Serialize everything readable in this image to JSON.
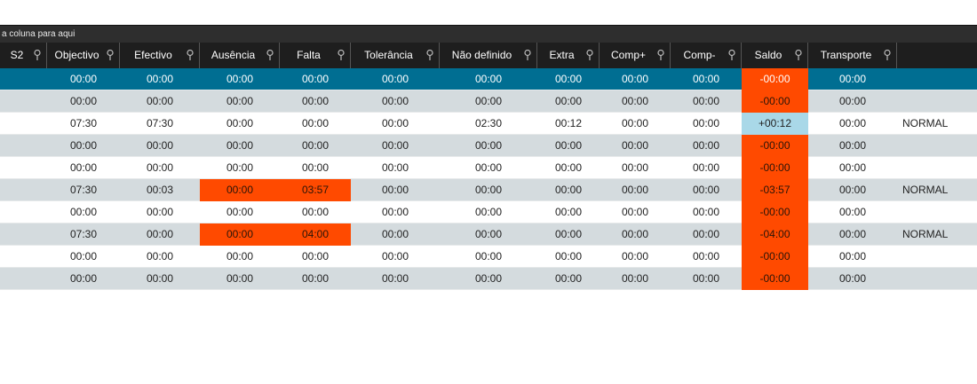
{
  "group_bar": {
    "text": "a coluna para aqui"
  },
  "columns": [
    {
      "key": "s2",
      "label": "S2",
      "width": 53
    },
    {
      "key": "objectivo",
      "label": "Objectivo",
      "width": 82
    },
    {
      "key": "efectivo",
      "label": "Efectivo",
      "width": 90
    },
    {
      "key": "ausencia",
      "label": "Ausência",
      "width": 90
    },
    {
      "key": "falta",
      "label": "Falta",
      "width": 80
    },
    {
      "key": "tolerancia",
      "label": "Tolerância",
      "width": 100
    },
    {
      "key": "nao_definido",
      "label": "Não definido",
      "width": 110
    },
    {
      "key": "extra",
      "label": "Extra",
      "width": 70
    },
    {
      "key": "comp_plus",
      "label": "Comp+",
      "width": 80
    },
    {
      "key": "comp_minus",
      "label": "Comp-",
      "width": 80
    },
    {
      "key": "saldo",
      "label": "Saldo",
      "width": 75
    },
    {
      "key": "transporte",
      "label": "Transporte",
      "width": 100
    },
    {
      "key": "info",
      "label": "",
      "width": 90
    }
  ],
  "rows": [
    {
      "style": "selected",
      "cells": {
        "s2": "",
        "objectivo": "00:00",
        "efectivo": "00:00",
        "ausencia": "00:00",
        "falta": "00:00",
        "tolerancia": "00:00",
        "nao_definido": "00:00",
        "extra": "00:00",
        "comp_plus": "00:00",
        "comp_minus": "00:00",
        "saldo": "-00:00",
        "transporte": "00:00",
        "info": ""
      },
      "highlight": {
        "saldo": "neg"
      }
    },
    {
      "style": "alt",
      "cells": {
        "s2": "",
        "objectivo": "00:00",
        "efectivo": "00:00",
        "ausencia": "00:00",
        "falta": "00:00",
        "tolerancia": "00:00",
        "nao_definido": "00:00",
        "extra": "00:00",
        "comp_plus": "00:00",
        "comp_minus": "00:00",
        "saldo": "-00:00",
        "transporte": "00:00",
        "info": ""
      },
      "highlight": {
        "saldo": "neg"
      }
    },
    {
      "style": "white",
      "cells": {
        "s2": "",
        "objectivo": "07:30",
        "efectivo": "07:30",
        "ausencia": "00:00",
        "falta": "00:00",
        "tolerancia": "00:00",
        "nao_definido": "02:30",
        "extra": "00:12",
        "comp_plus": "00:00",
        "comp_minus": "00:00",
        "saldo": "+00:12",
        "transporte": "00:00",
        "info": "NORMAL"
      },
      "highlight": {
        "saldo": "pos"
      }
    },
    {
      "style": "alt",
      "cells": {
        "s2": "",
        "objectivo": "00:00",
        "efectivo": "00:00",
        "ausencia": "00:00",
        "falta": "00:00",
        "tolerancia": "00:00",
        "nao_definido": "00:00",
        "extra": "00:00",
        "comp_plus": "00:00",
        "comp_minus": "00:00",
        "saldo": "-00:00",
        "transporte": "00:00",
        "info": ""
      },
      "highlight": {
        "saldo": "neg"
      }
    },
    {
      "style": "white",
      "cells": {
        "s2": "",
        "objectivo": "00:00",
        "efectivo": "00:00",
        "ausencia": "00:00",
        "falta": "00:00",
        "tolerancia": "00:00",
        "nao_definido": "00:00",
        "extra": "00:00",
        "comp_plus": "00:00",
        "comp_minus": "00:00",
        "saldo": "-00:00",
        "transporte": "00:00",
        "info": ""
      },
      "highlight": {
        "saldo": "neg"
      }
    },
    {
      "style": "alt",
      "cells": {
        "s2": "",
        "objectivo": "07:30",
        "efectivo": "00:03",
        "ausencia": "00:00",
        "falta": "03:57",
        "tolerancia": "00:00",
        "nao_definido": "00:00",
        "extra": "00:00",
        "comp_plus": "00:00",
        "comp_minus": "00:00",
        "saldo": "-03:57",
        "transporte": "00:00",
        "info": "NORMAL"
      },
      "highlight": {
        "ausencia": "orange",
        "falta": "orange",
        "saldo": "neg"
      }
    },
    {
      "style": "white",
      "cells": {
        "s2": "",
        "objectivo": "00:00",
        "efectivo": "00:00",
        "ausencia": "00:00",
        "falta": "00:00",
        "tolerancia": "00:00",
        "nao_definido": "00:00",
        "extra": "00:00",
        "comp_plus": "00:00",
        "comp_minus": "00:00",
        "saldo": "-00:00",
        "transporte": "00:00",
        "info": ""
      },
      "highlight": {
        "saldo": "neg"
      }
    },
    {
      "style": "alt",
      "cells": {
        "s2": "",
        "objectivo": "07:30",
        "efectivo": "00:00",
        "ausencia": "00:00",
        "falta": "04:00",
        "tolerancia": "00:00",
        "nao_definido": "00:00",
        "extra": "00:00",
        "comp_plus": "00:00",
        "comp_minus": "00:00",
        "saldo": "-04:00",
        "transporte": "00:00",
        "info": "NORMAL"
      },
      "highlight": {
        "ausencia": "orange",
        "falta": "orange",
        "saldo": "neg"
      }
    },
    {
      "style": "white",
      "cells": {
        "s2": "",
        "objectivo": "00:00",
        "efectivo": "00:00",
        "ausencia": "00:00",
        "falta": "00:00",
        "tolerancia": "00:00",
        "nao_definido": "00:00",
        "extra": "00:00",
        "comp_plus": "00:00",
        "comp_minus": "00:00",
        "saldo": "-00:00",
        "transporte": "00:00",
        "info": ""
      },
      "highlight": {
        "saldo": "neg"
      }
    },
    {
      "style": "alt",
      "cells": {
        "s2": "",
        "objectivo": "00:00",
        "efectivo": "00:00",
        "ausencia": "00:00",
        "falta": "00:00",
        "tolerancia": "00:00",
        "nao_definido": "00:00",
        "extra": "00:00",
        "comp_plus": "00:00",
        "comp_minus": "00:00",
        "saldo": "-00:00",
        "transporte": "00:00",
        "info": ""
      },
      "highlight": {
        "saldo": "neg"
      }
    }
  ],
  "icons": {
    "column_pin": "pin-icon"
  },
  "colors": {
    "negative": "#ff4a00",
    "positive": "#a9d8e8",
    "selected": "#006e92",
    "header": "#1e1e1e"
  }
}
